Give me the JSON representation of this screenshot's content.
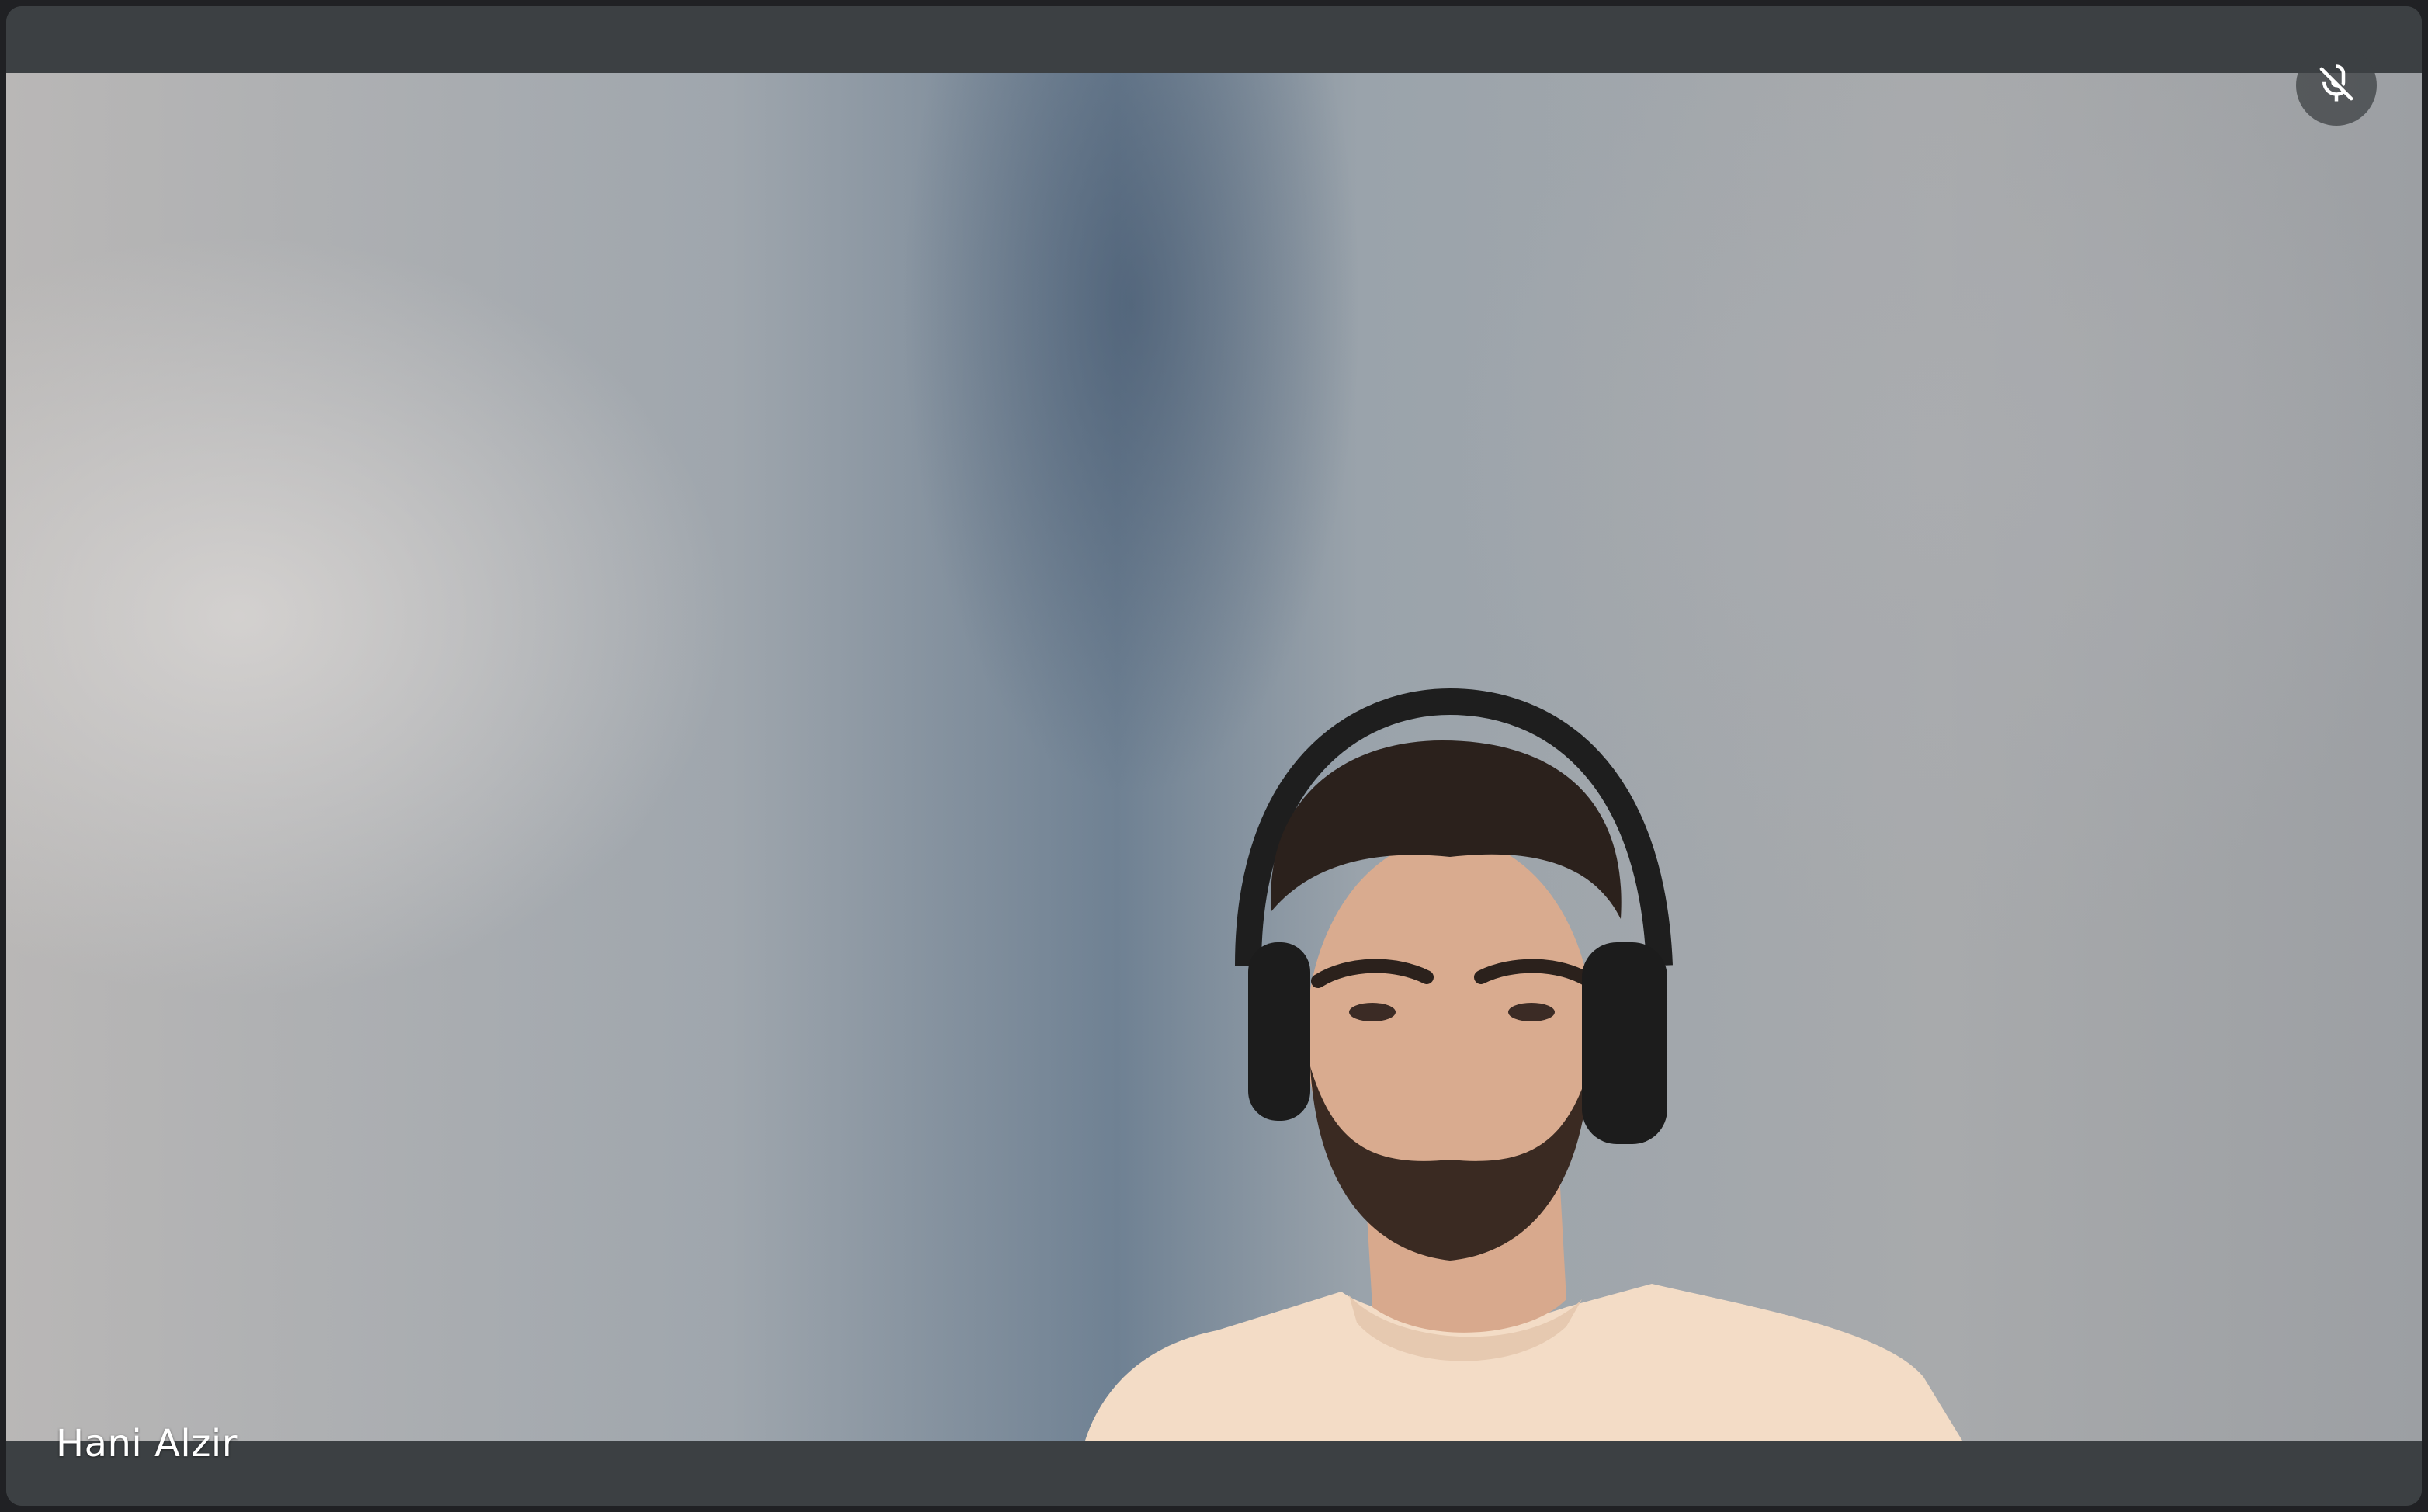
{
  "participant": {
    "name": "Hani Alzir",
    "microphone_muted": true
  },
  "icons": {
    "mic_status": "mic-off-icon"
  },
  "colors": {
    "tile_background": "#3c4043",
    "page_background": "#202124",
    "name_text": "#ffffff",
    "mic_badge_bg": "#5f6368"
  }
}
